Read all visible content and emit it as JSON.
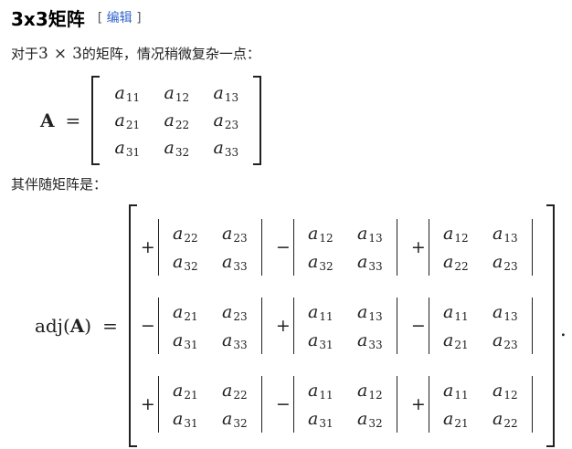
{
  "section": {
    "title": "3x3矩阵",
    "edit_open": "[",
    "edit_label": "编辑",
    "edit_close": "]"
  },
  "intro": {
    "prefix": "对于",
    "n1": "3",
    "times": "×",
    "n2": "3",
    "suffix": "的矩阵，情况稍微复杂一点："
  },
  "matrix_eq": {
    "lhs": "A",
    "equals": "=",
    "rows": [
      [
        {
          "base": "a",
          "sub": "11"
        },
        {
          "base": "a",
          "sub": "12"
        },
        {
          "base": "a",
          "sub": "13"
        }
      ],
      [
        {
          "base": "a",
          "sub": "21"
        },
        {
          "base": "a",
          "sub": "22"
        },
        {
          "base": "a",
          "sub": "23"
        }
      ],
      [
        {
          "base": "a",
          "sub": "31"
        },
        {
          "base": "a",
          "sub": "32"
        },
        {
          "base": "a",
          "sub": "33"
        }
      ]
    ]
  },
  "adj_intro": "其伴随矩阵是：",
  "adj_eq": {
    "lhs_func": "adj",
    "lhs_open": "(",
    "lhs_arg": "A",
    "lhs_close": ")",
    "equals": "=",
    "period": ".",
    "cells": [
      {
        "sign": "+",
        "det": [
          [
            "22",
            "23"
          ],
          [
            "32",
            "33"
          ]
        ]
      },
      {
        "sign": "−",
        "det": [
          [
            "12",
            "13"
          ],
          [
            "32",
            "33"
          ]
        ]
      },
      {
        "sign": "+",
        "det": [
          [
            "12",
            "13"
          ],
          [
            "22",
            "23"
          ]
        ]
      },
      {
        "sign": "−",
        "det": [
          [
            "21",
            "23"
          ],
          [
            "31",
            "33"
          ]
        ]
      },
      {
        "sign": "+",
        "det": [
          [
            "11",
            "13"
          ],
          [
            "31",
            "33"
          ]
        ]
      },
      {
        "sign": "−",
        "det": [
          [
            "11",
            "13"
          ],
          [
            "21",
            "23"
          ]
        ]
      },
      {
        "sign": "+",
        "det": [
          [
            "21",
            "22"
          ],
          [
            "31",
            "32"
          ]
        ]
      },
      {
        "sign": "−",
        "det": [
          [
            "11",
            "12"
          ],
          [
            "31",
            "32"
          ]
        ]
      },
      {
        "sign": "+",
        "det": [
          [
            "11",
            "12"
          ],
          [
            "21",
            "22"
          ]
        ]
      }
    ],
    "entry_base": "a"
  }
}
